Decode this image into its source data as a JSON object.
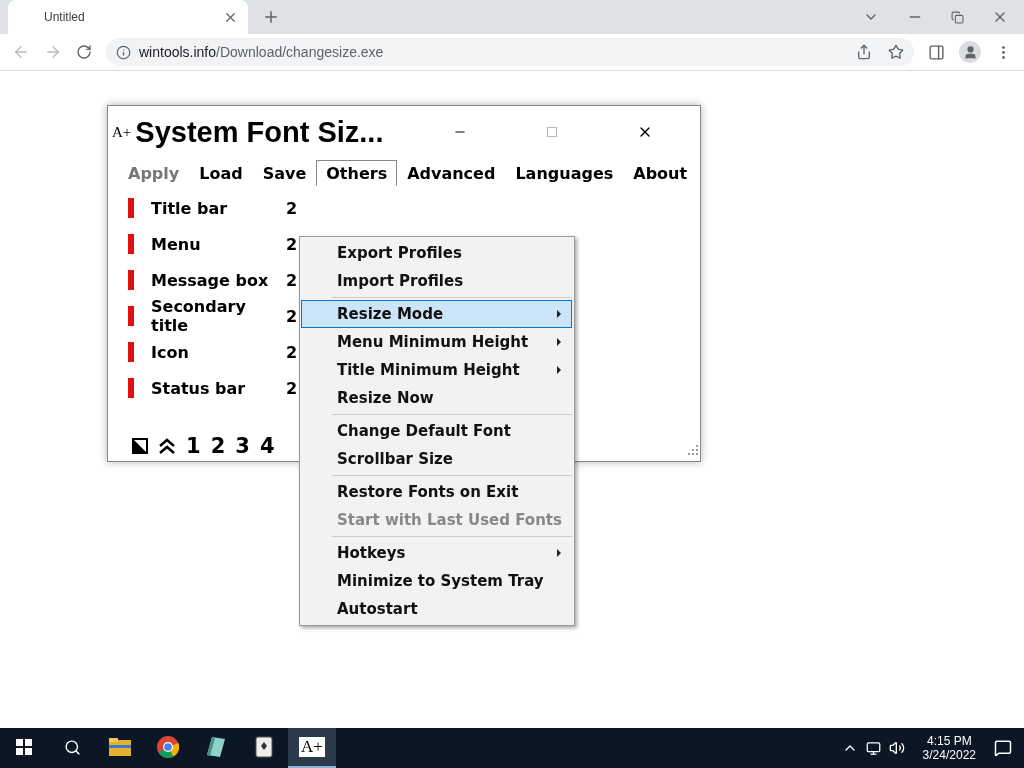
{
  "browser": {
    "tab_title": "Untitled",
    "url_host": "wintools.info",
    "url_path": "/Download/changesize.exe"
  },
  "app": {
    "icon_text": "A+",
    "title": "System Font Siz...",
    "menu_bar": [
      {
        "label": "Apply",
        "disabled": true,
        "selected": false
      },
      {
        "label": "Load",
        "disabled": false,
        "selected": false
      },
      {
        "label": "Save",
        "disabled": false,
        "selected": false
      },
      {
        "label": "Others",
        "disabled": false,
        "selected": true
      },
      {
        "label": "Advanced",
        "disabled": false,
        "selected": false
      },
      {
        "label": "Languages",
        "disabled": false,
        "selected": false
      },
      {
        "label": "About",
        "disabled": false,
        "selected": false
      }
    ],
    "font_rows": [
      {
        "name": "Title bar",
        "size": "2",
        "color": "#e01010"
      },
      {
        "name": "Menu",
        "size": "2",
        "color": "#e01010"
      },
      {
        "name": "Message box",
        "size": "2",
        "color": "#e01010"
      },
      {
        "name": "Secondary title",
        "size": "2",
        "color": "#e01010"
      },
      {
        "name": "Icon",
        "size": "2",
        "color": "#e01010"
      },
      {
        "name": "Status bar",
        "size": "2",
        "color": "#e01010"
      }
    ],
    "presets": [
      "1",
      "2",
      "3",
      "4"
    ],
    "dropdown": [
      {
        "kind": "item",
        "label": "Export Profiles",
        "disabled": false,
        "selected": false,
        "submenu": false
      },
      {
        "kind": "item",
        "label": "Import Profiles",
        "disabled": false,
        "selected": false,
        "submenu": false
      },
      {
        "kind": "separator"
      },
      {
        "kind": "item",
        "label": "Resize Mode",
        "disabled": false,
        "selected": true,
        "submenu": true
      },
      {
        "kind": "item",
        "label": "Menu Minimum Height",
        "disabled": false,
        "selected": false,
        "submenu": true
      },
      {
        "kind": "item",
        "label": "Title Minimum Height",
        "disabled": false,
        "selected": false,
        "submenu": true
      },
      {
        "kind": "item",
        "label": "Resize Now",
        "disabled": false,
        "selected": false,
        "submenu": false
      },
      {
        "kind": "separator"
      },
      {
        "kind": "item",
        "label": "Change Default Font",
        "disabled": false,
        "selected": false,
        "submenu": false
      },
      {
        "kind": "item",
        "label": "Scrollbar Size",
        "disabled": false,
        "selected": false,
        "submenu": false
      },
      {
        "kind": "separator"
      },
      {
        "kind": "item",
        "label": "Restore Fonts on Exit",
        "disabled": false,
        "selected": false,
        "submenu": false
      },
      {
        "kind": "item",
        "label": "Start with Last Used Fonts",
        "disabled": true,
        "selected": false,
        "submenu": false
      },
      {
        "kind": "separator"
      },
      {
        "kind": "item",
        "label": "Hotkeys",
        "disabled": false,
        "selected": false,
        "submenu": true
      },
      {
        "kind": "item",
        "label": "Minimize to System Tray",
        "disabled": false,
        "selected": false,
        "submenu": false
      },
      {
        "kind": "item",
        "label": "Autostart",
        "disabled": false,
        "selected": false,
        "submenu": false
      }
    ]
  },
  "taskbar": {
    "apps": [
      {
        "kind": "folder",
        "selected": false
      },
      {
        "kind": "chrome",
        "selected": false
      },
      {
        "kind": "notebook",
        "selected": false
      },
      {
        "kind": "cards",
        "selected": false
      },
      {
        "kind": "fontapp",
        "selected": true
      }
    ],
    "app_icon_text": "A+",
    "time": "4:15 PM",
    "date": "3/24/2022"
  }
}
